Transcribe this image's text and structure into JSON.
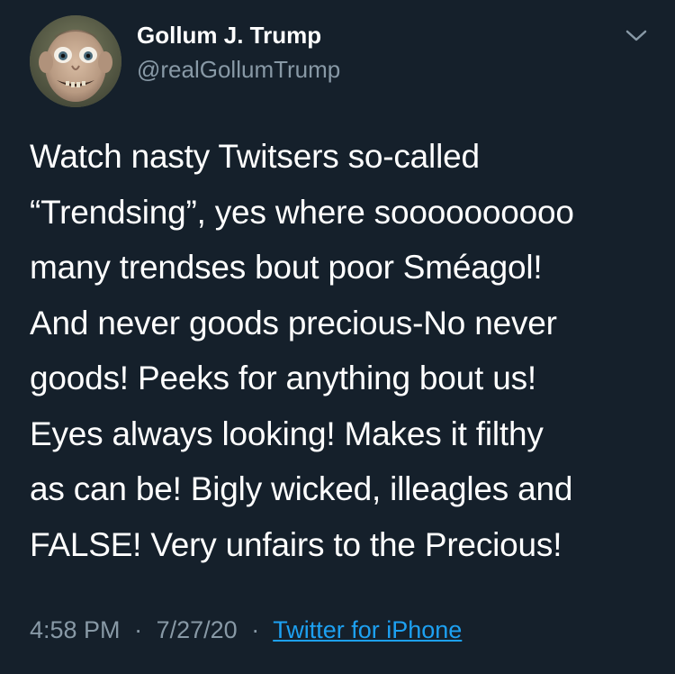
{
  "author": {
    "display_name": "Gollum J. Trump",
    "handle": "@realGollumTrump",
    "avatar_icon": "avatar-photo"
  },
  "menu_icon": "chevron-down-icon",
  "tweet": {
    "lines": [
      "Watch nasty Twitsers so-called",
      "“Trendsing”, yes where soooooooooo",
      "many trendses bout poor Sméagol!",
      "And never goods precious-No never",
      "goods! Peeks for anything bout us!",
      "Eyes always looking! Makes it filthy",
      "as can be! Bigly wicked, illeagles and",
      "FALSE! Very unfairs to the Precious!"
    ]
  },
  "meta": {
    "time": "4:58 PM",
    "separator": "·",
    "date": "7/27/20",
    "source": "Twitter for iPhone"
  },
  "colors": {
    "background": "#15202b",
    "primary_text": "#ffffff",
    "secondary_text": "#8899a6",
    "link": "#1da1f2"
  }
}
